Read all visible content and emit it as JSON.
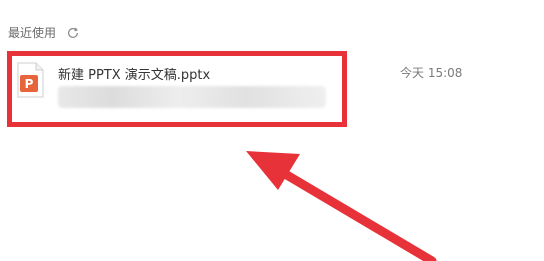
{
  "section": {
    "title": "最近使用",
    "refresh_icon": "refresh-icon"
  },
  "recent_files": [
    {
      "name": "新建 PPTX 演示文稿.pptx",
      "time": "今天 15:08",
      "icon": "ppt-file-icon",
      "icon_letter": "P"
    }
  ],
  "colors": {
    "highlight_red": "#e8323a",
    "ppt_orange": "#e8643a"
  }
}
